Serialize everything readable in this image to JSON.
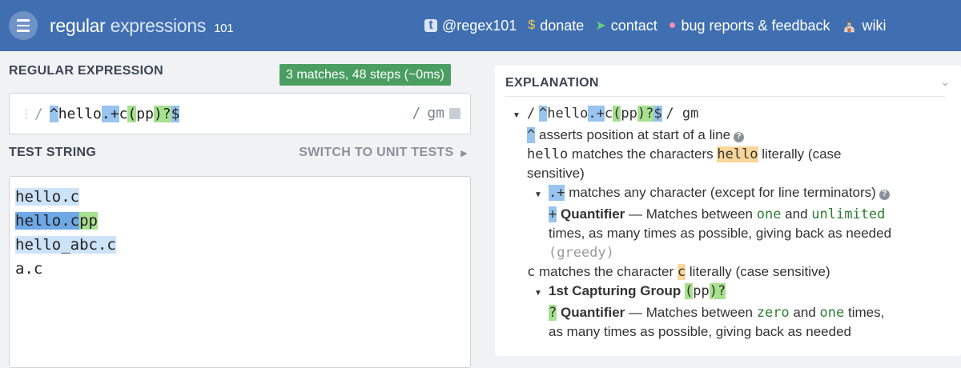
{
  "header": {
    "brand_main": "regular",
    "brand_sub": "expressions",
    "brand_num": "101",
    "nav": [
      {
        "label": "@regex101",
        "icon": "twitter-icon"
      },
      {
        "label": "donate",
        "icon": "dollar-icon"
      },
      {
        "label": "contact",
        "icon": "send-icon"
      },
      {
        "label": "bug reports & feedback",
        "icon": "bug-icon"
      },
      {
        "label": "wiki",
        "icon": "bank-icon"
      }
    ]
  },
  "regex": {
    "section_title": "REGULAR EXPRESSION",
    "match_info": "3 matches, 48 steps (~0ms)",
    "slash": "/",
    "tokens": [
      "^",
      "hello",
      ".+",
      "c",
      "(",
      "pp",
      ")",
      "?",
      "$"
    ],
    "close_slash": "/",
    "flags": "gm"
  },
  "test": {
    "section_title": "TEST STRING",
    "switch_label": "SWITCH TO UNIT TESTS",
    "lines": [
      {
        "parts": [
          "hello.c"
        ]
      },
      {
        "parts": [
          "hello.c",
          "pp"
        ]
      },
      {
        "parts": [
          "hello_abc.c"
        ]
      },
      {
        "parts": [
          "a.c"
        ]
      }
    ]
  },
  "explanation": {
    "title": "EXPLANATION",
    "root": {
      "open": "/",
      "tokens": [
        "^",
        "hello",
        ".+",
        "c",
        "(",
        "pp",
        ")",
        "?",
        "$"
      ],
      "close": "/ gm"
    },
    "caret_token": "^",
    "caret_text": "asserts position at start of a line",
    "hello_token": "hello",
    "hello_text_a": "matches the characters",
    "hello_hl": "hello",
    "hello_text_b": "literally (case",
    "hello_text_c": "sensitive)",
    "dotplus_token": ".+",
    "dotplus_text": "matches any character (except for line terminators)",
    "plus_token": "+",
    "quantifier_label": "Quantifier",
    "q1_text_a": "— Matches between",
    "q1_one": "one",
    "q1_and": "and",
    "q1_unlimited": "unlimited",
    "q1_text_b": "times, as many times as possible, giving back as needed",
    "q1_greedy": "(greedy)",
    "c_token": "c",
    "c_text_a": "matches the character",
    "c_hl": "c",
    "c_text_b": "literally (case sensitive)",
    "group_label": "1st Capturing Group",
    "group_tokens": [
      "(",
      "pp",
      ")",
      "?"
    ],
    "q2_token": "?",
    "q2_text_a": "— Matches between",
    "q2_zero": "zero",
    "q2_and": "and",
    "q2_one": "one",
    "q2_text_b": "times,",
    "q2_text_c": "as many times as possible, giving back as needed"
  }
}
